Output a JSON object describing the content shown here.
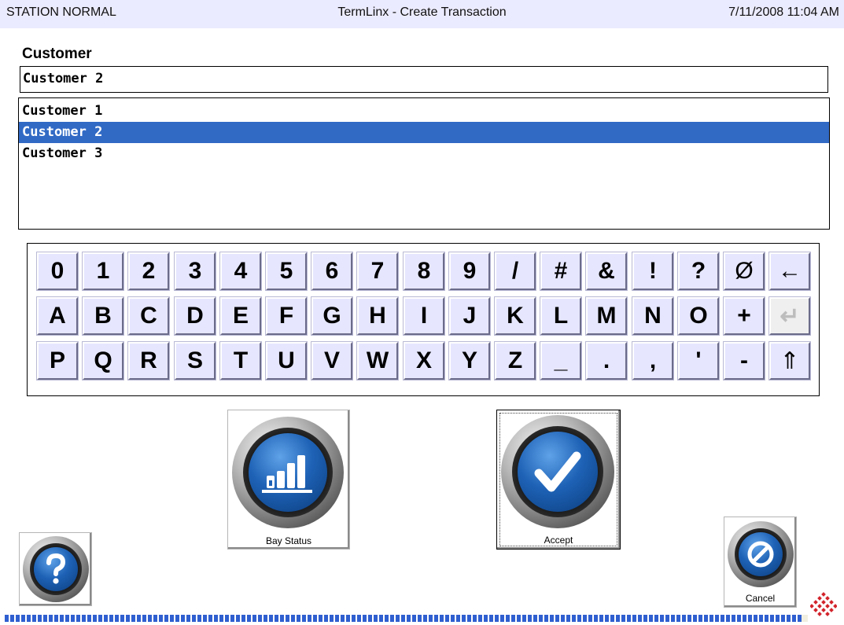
{
  "titlebar": {
    "status": "STATION NORMAL",
    "title": "TermLinx - Create Transaction",
    "datetime": "7/11/2008 11:04 AM"
  },
  "customer": {
    "label": "Customer",
    "value": "Customer 2",
    "options": [
      "Customer 1",
      "Customer 2",
      "Customer 3"
    ],
    "selected_index": 1
  },
  "keyboard": {
    "rows": [
      [
        "0",
        "1",
        "2",
        "3",
        "4",
        "5",
        "6",
        "7",
        "8",
        "9",
        "/",
        "#",
        "&",
        "!",
        "?",
        "Ø",
        "←"
      ],
      [
        "A",
        "B",
        "C",
        "D",
        "E",
        "F",
        "G",
        "H",
        "I",
        "J",
        "K",
        "L",
        "M",
        "N",
        "O",
        "+",
        "↵"
      ],
      [
        "P",
        "Q",
        "R",
        "S",
        "T",
        "U",
        "V",
        "W",
        "X",
        "Y",
        "Z",
        "_",
        ".",
        ",",
        "'",
        "-",
        "⇑"
      ]
    ],
    "disabled_keys": [
      "↵"
    ]
  },
  "buttons": {
    "bay_status": "Bay Status",
    "accept": "Accept",
    "cancel": "Cancel",
    "help_icon": "question-icon"
  },
  "colors": {
    "titlebar_bg": "#ebebff",
    "selection": "#316ac5",
    "key_face": "#e6e6ff",
    "orb_blue": "#1e62b6",
    "strip_blue": "#2f5fd0",
    "logo_red": "#d2232a"
  }
}
